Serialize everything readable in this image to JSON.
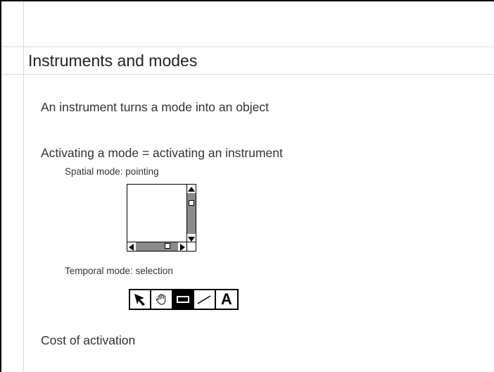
{
  "slide": {
    "title": "Instruments and modes",
    "bullets": [
      "An instrument turns a mode into an object",
      "Activating a mode = activating an instrument",
      "Cost of activation"
    ],
    "sub_bullets": [
      "Spatial mode: pointing",
      "Temporal mode: selection"
    ]
  },
  "toolbar": {
    "tools": [
      {
        "icon": "arrow-pointer-icon",
        "selected": false
      },
      {
        "icon": "hand-icon",
        "selected": false
      },
      {
        "icon": "rectangle-icon",
        "selected": true
      },
      {
        "icon": "line-icon",
        "selected": false
      },
      {
        "icon": "text-tool-icon",
        "label": "A",
        "selected": false
      }
    ]
  },
  "colors": {
    "scrollbar_track": "#8a8a8a",
    "selected_tool": "#000000"
  }
}
